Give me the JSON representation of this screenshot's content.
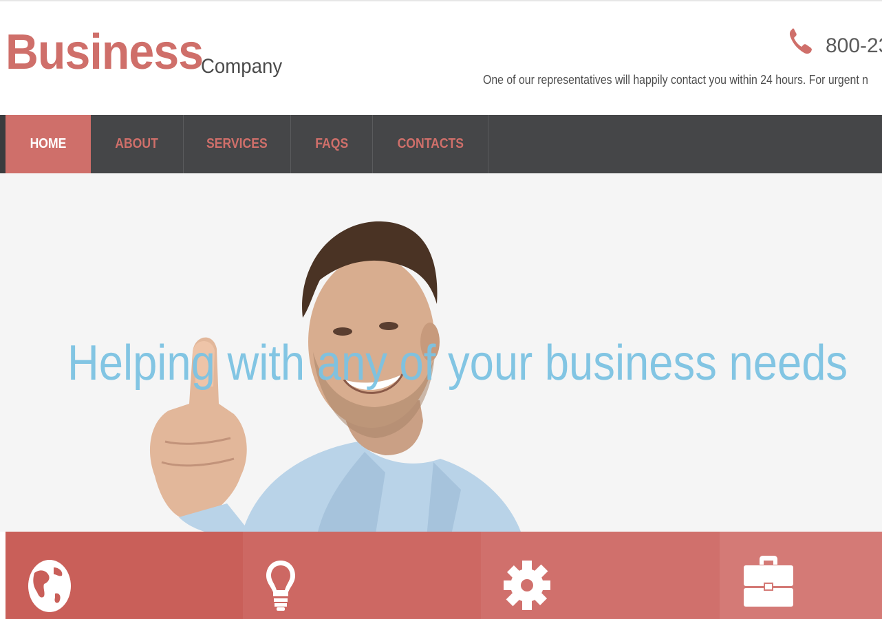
{
  "header": {
    "logo_main": "Business",
    "logo_sub": "Company",
    "phone_number": "800-23",
    "contact_note": "One of our representatives will happily contact you within 24 hours. For urgent n"
  },
  "nav": {
    "items": [
      {
        "label": "HOME",
        "active": true
      },
      {
        "label": "ABOUT",
        "active": false
      },
      {
        "label": "SERVICES",
        "active": false
      },
      {
        "label": "FAQS",
        "active": false
      },
      {
        "label": "CONTACTS",
        "active": false
      }
    ]
  },
  "hero": {
    "headline": "Helping with any of your business needs"
  },
  "tiles": [
    {
      "icon": "globe-icon"
    },
    {
      "icon": "lightbulb-icon"
    },
    {
      "icon": "gear-icon"
    },
    {
      "icon": "briefcase-icon"
    }
  ],
  "colors": {
    "accent": "#cf6f6a",
    "nav_bg": "#454648",
    "headline": "#7cc3e3"
  }
}
